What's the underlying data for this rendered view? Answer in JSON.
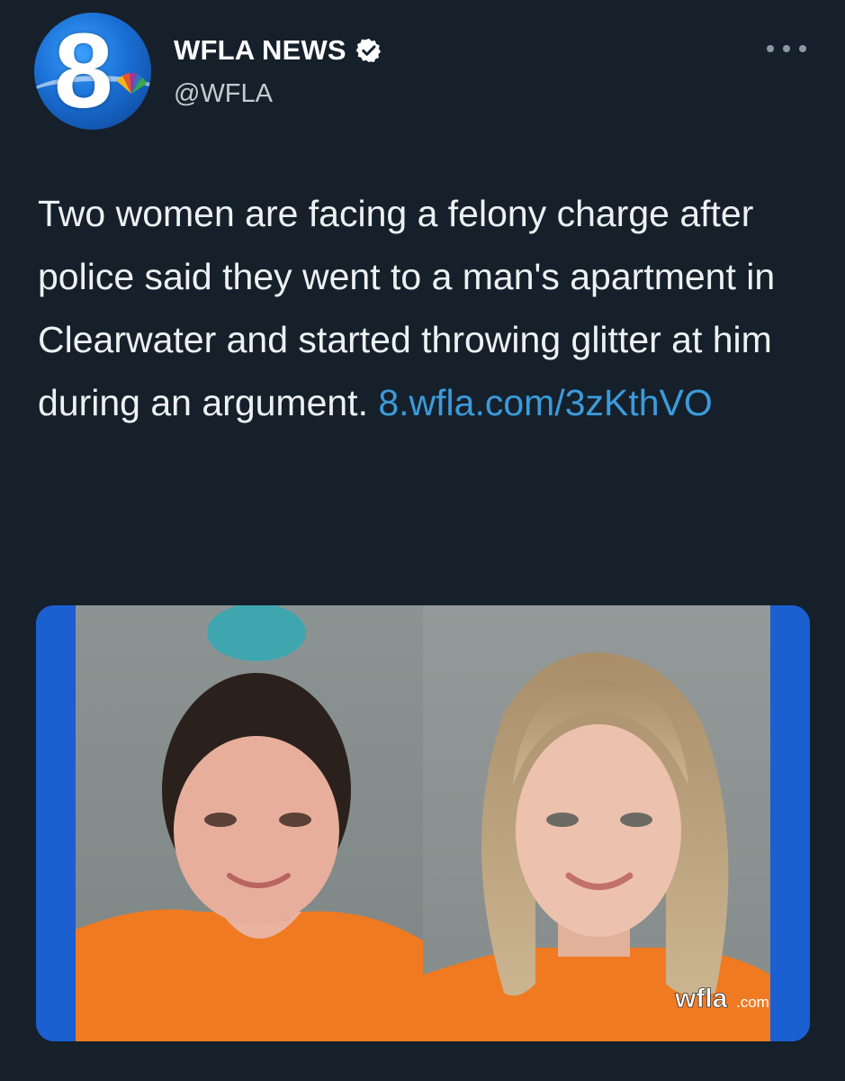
{
  "header": {
    "display_name": "WFLA NEWS",
    "handle": "@WFLA",
    "avatar_icon": "wfla-8-logo-icon",
    "verified_icon": "verified-badge-icon",
    "more_icon": "more-options-icon"
  },
  "tweet": {
    "text": "Two women are facing a felony charge after police said they went to a man's apartment in Clearwater and started throwing glitter at him during an argument. ",
    "link": "8.wfla.com/​3zKthVO"
  },
  "media": {
    "watermark_main": "wfla",
    "watermark_suffix": ".com"
  },
  "colors": {
    "background": "#15202b",
    "link": "#3b9bdb",
    "frame_blue": "#1b5fd0",
    "jumpsuit": "#f07a22"
  }
}
